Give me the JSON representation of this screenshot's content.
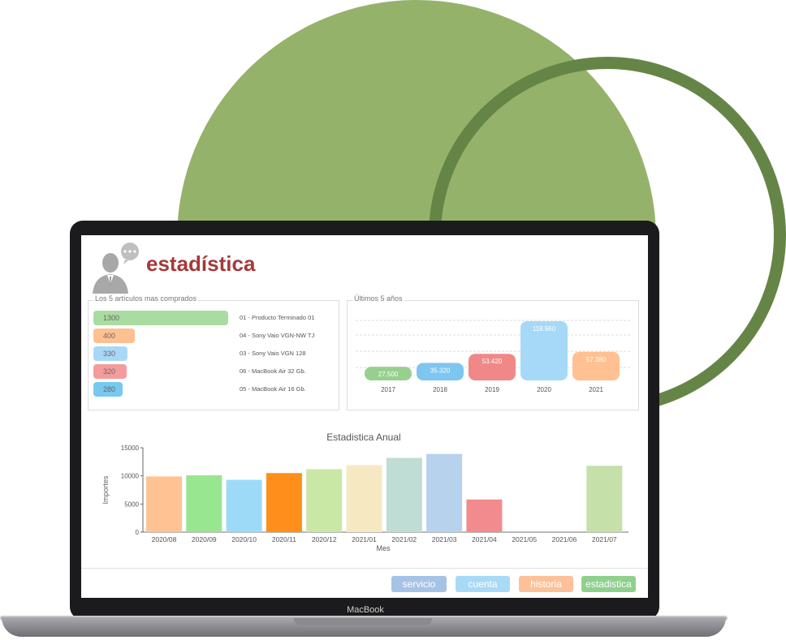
{
  "header": {
    "title": "estadística"
  },
  "top5": {
    "title": "Los 5 artículos mas comprados",
    "items": [
      {
        "value": "1300",
        "label": "01 - Producto Terminado 01",
        "color": "#a9dca0",
        "fraction": 1.0
      },
      {
        "value": "400",
        "label": "04 - Sony Vaio VGN-NW TJ",
        "color": "#ffc091",
        "fraction": 0.308
      },
      {
        "value": "330",
        "label": "03 - Sony Vaio VGN 128",
        "color": "#a9d8f7",
        "fraction": 0.254
      },
      {
        "value": "320",
        "label": "06 - MacBook Air 32 Gb.",
        "color": "#f49c9c",
        "fraction": 0.246
      },
      {
        "value": "280",
        "label": "05 - MacBook Air 16 Gb.",
        "color": "#78c8f0",
        "fraction": 0.215
      }
    ]
  },
  "years_chart": {
    "title": "Últimos 5 años",
    "categories": [
      "2017",
      "2018",
      "2019",
      "2020",
      "2021"
    ],
    "labels": [
      "27.500",
      "35.320",
      "53.420",
      "118.960",
      "57.380"
    ],
    "values": [
      27500,
      35320,
      53420,
      118960,
      57380
    ],
    "colors": [
      "#97d08e",
      "#7cc6f0",
      "#f08888",
      "#a6d9f7",
      "#ffc192"
    ]
  },
  "chart_data": {
    "type": "bar",
    "title": "Estadistica Anual",
    "xlabel": "Mes",
    "ylabel": "Importes",
    "categories": [
      "2020/08",
      "2020/09",
      "2020/10",
      "2020/11",
      "2020/12",
      "2021/01",
      "2021/02",
      "2021/03",
      "2021/04",
      "2021/05",
      "2021/06",
      "2021/07"
    ],
    "values": [
      9900,
      10100,
      9300,
      10500,
      11200,
      11900,
      13200,
      13900,
      5800,
      0,
      0,
      11800
    ],
    "colors": [
      "#ffc393",
      "#98e68f",
      "#9cdaf8",
      "#ff8f1a",
      "#c9e8a6",
      "#f6e9c2",
      "#bfdcd5",
      "#b6d2ec",
      "#f28b8e",
      "#cccccc",
      "#cccccc",
      "#c5e0a8"
    ],
    "ylim": [
      0,
      15000
    ],
    "yticks": [
      "0",
      "5000",
      "10000",
      "15000"
    ],
    "ytick_values": [
      0,
      5000,
      10000,
      15000
    ]
  },
  "nav": {
    "buttons": [
      {
        "label": "servicio",
        "color": "#a6c3e6"
      },
      {
        "label": "cuenta",
        "color": "#a8daf7"
      },
      {
        "label": "historia",
        "color": "#fcc199"
      },
      {
        "label": "estadistica",
        "color": "#8fd08d"
      }
    ]
  },
  "device": {
    "brand": "MacBook"
  }
}
